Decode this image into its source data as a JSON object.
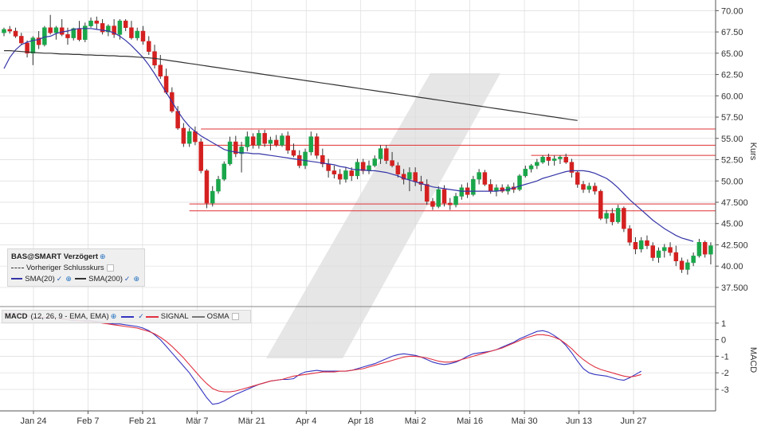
{
  "chart_data": {
    "type": "candlestick",
    "instrument": "BAS@SMART Verzögert",
    "x_ticks": [
      "Jan 24",
      "Feb 7",
      "Feb 21",
      "Mär 7",
      "Mär 21",
      "Apr 4",
      "Apr 18",
      "Mai 2",
      "Mai 16",
      "Mai 30",
      "Jun 13",
      "Jun 27"
    ],
    "price_axis": {
      "label": "Kurs",
      "ylim": [
        35.25,
        71.25
      ],
      "ticks": [
        "70.00",
        "67.50",
        "65.00",
        "62.50",
        "60.00",
        "57.50",
        "55.00",
        "52.50",
        "50.00",
        "47.500",
        "45.00",
        "42.500",
        "40.00",
        "37.500"
      ]
    },
    "macd_axis": {
      "label": "MACD",
      "ylim": [
        -4.3,
        2.0
      ],
      "ticks": [
        "1",
        "0",
        "-1",
        "-2",
        "-3"
      ]
    },
    "candles": [
      [
        67.4,
        68.0,
        67.0,
        67.8
      ],
      [
        67.8,
        68.2,
        67.3,
        67.6
      ],
      [
        67.6,
        68.0,
        66.8,
        67.0
      ],
      [
        67.0,
        67.4,
        66.0,
        66.2
      ],
      [
        66.2,
        66.5,
        64.5,
        65.0
      ],
      [
        65.0,
        67.0,
        63.6,
        66.8
      ],
      [
        66.8,
        67.6,
        65.5,
        66.0
      ],
      [
        66.0,
        68.2,
        65.8,
        68.0
      ],
      [
        68.0,
        69.5,
        67.2,
        67.4
      ],
      [
        67.4,
        68.2,
        66.6,
        68.0
      ],
      [
        68.0,
        69.0,
        67.0,
        67.2
      ],
      [
        67.2,
        68.0,
        66.0,
        66.8
      ],
      [
        66.8,
        68.0,
        66.5,
        67.9
      ],
      [
        67.9,
        68.8,
        66.4,
        66.6
      ],
      [
        66.6,
        68.6,
        66.3,
        68.2
      ],
      [
        68.2,
        69.2,
        68.0,
        68.8
      ],
      [
        68.8,
        69.3,
        67.8,
        68.5
      ],
      [
        68.5,
        69.0,
        67.2,
        67.5
      ],
      [
        67.5,
        68.4,
        67.0,
        68.2
      ],
      [
        68.2,
        69.0,
        66.8,
        67.2
      ],
      [
        67.2,
        69.0,
        66.6,
        68.8
      ],
      [
        68.8,
        69.0,
        67.6,
        68.0
      ],
      [
        68.0,
        68.8,
        66.6,
        66.8
      ],
      [
        66.8,
        68.0,
        66.5,
        67.6
      ],
      [
        67.6,
        68.2,
        66.0,
        66.4
      ],
      [
        66.4,
        67.0,
        64.8,
        65.2
      ],
      [
        65.2,
        66.0,
        63.2,
        63.6
      ],
      [
        63.6,
        64.8,
        62.0,
        62.3
      ],
      [
        62.3,
        63.2,
        60.2,
        60.4
      ],
      [
        60.4,
        61.0,
        58.0,
        58.2
      ],
      [
        58.2,
        58.8,
        56.0,
        56.2
      ],
      [
        56.2,
        56.8,
        54.0,
        54.4
      ],
      [
        54.4,
        56.2,
        54.0,
        55.8
      ],
      [
        55.8,
        56.4,
        54.2,
        54.6
      ],
      [
        54.6,
        55.0,
        50.9,
        51.2
      ],
      [
        51.2,
        51.4,
        46.8,
        47.4
      ],
      [
        47.4,
        49.4,
        47.0,
        48.8
      ],
      [
        48.8,
        50.6,
        48.5,
        50.2
      ],
      [
        50.2,
        52.3,
        50.0,
        52.0
      ],
      [
        52.0,
        55.2,
        51.8,
        54.6
      ],
      [
        54.6,
        55.3,
        52.8,
        53.2
      ],
      [
        53.2,
        54.6,
        51.0,
        54.0
      ],
      [
        54.0,
        55.8,
        53.5,
        55.2
      ],
      [
        55.2,
        55.6,
        53.8,
        54.2
      ],
      [
        54.2,
        56.0,
        53.8,
        55.6
      ],
      [
        55.6,
        56.0,
        54.0,
        54.4
      ],
      [
        54.4,
        55.2,
        53.6,
        54.8
      ],
      [
        54.8,
        55.4,
        54.0,
        54.2
      ],
      [
        54.2,
        55.6,
        54.0,
        55.3
      ],
      [
        55.3,
        55.8,
        53.2,
        53.6
      ],
      [
        53.6,
        54.4,
        52.8,
        53.0
      ],
      [
        53.0,
        53.6,
        51.5,
        51.8
      ],
      [
        51.8,
        53.8,
        51.4,
        53.4
      ],
      [
        53.4,
        55.8,
        53.0,
        55.2
      ],
      [
        55.2,
        55.6,
        52.6,
        53.0
      ],
      [
        53.0,
        53.8,
        51.6,
        52.0
      ],
      [
        52.0,
        52.6,
        50.4,
        51.2
      ],
      [
        51.2,
        51.8,
        50.3,
        50.8
      ],
      [
        50.8,
        51.4,
        49.6,
        50.2
      ],
      [
        50.2,
        51.6,
        49.8,
        51.2
      ],
      [
        51.2,
        51.6,
        50.0,
        50.6
      ],
      [
        50.6,
        52.6,
        50.2,
        52.2
      ],
      [
        52.2,
        52.6,
        50.8,
        51.2
      ],
      [
        51.2,
        52.4,
        50.8,
        51.8
      ],
      [
        51.8,
        53.0,
        51.6,
        52.6
      ],
      [
        52.6,
        54.2,
        52.0,
        53.8
      ],
      [
        53.8,
        54.2,
        52.0,
        52.4
      ],
      [
        52.4,
        53.4,
        51.6,
        51.8
      ],
      [
        51.8,
        52.2,
        50.4,
        50.8
      ],
      [
        50.8,
        51.4,
        49.6,
        50.2
      ],
      [
        50.2,
        51.6,
        48.8,
        51.0
      ],
      [
        51.0,
        51.6,
        49.4,
        49.9
      ],
      [
        49.9,
        50.6,
        48.8,
        49.6
      ],
      [
        49.6,
        50.2,
        47.2,
        47.6
      ],
      [
        47.6,
        48.0,
        46.6,
        47.0
      ],
      [
        47.0,
        49.4,
        46.8,
        49.0
      ],
      [
        49.0,
        49.5,
        47.0,
        47.4
      ],
      [
        47.4,
        48.0,
        46.6,
        47.2
      ],
      [
        47.2,
        48.6,
        46.9,
        48.2
      ],
      [
        48.2,
        49.6,
        47.8,
        49.2
      ],
      [
        49.2,
        49.8,
        48.0,
        48.4
      ],
      [
        48.4,
        50.6,
        48.2,
        50.2
      ],
      [
        50.2,
        51.4,
        49.6,
        51.0
      ],
      [
        51.0,
        51.3,
        49.4,
        49.6
      ],
      [
        49.6,
        50.2,
        48.5,
        48.8
      ],
      [
        48.8,
        49.6,
        48.2,
        49.2
      ],
      [
        49.2,
        49.6,
        48.6,
        48.8
      ],
      [
        48.8,
        49.6,
        48.4,
        49.3
      ],
      [
        49.3,
        49.8,
        48.6,
        49.0
      ],
      [
        49.0,
        50.8,
        48.8,
        50.6
      ],
      [
        50.6,
        51.8,
        50.4,
        51.4
      ],
      [
        51.4,
        52.0,
        51.0,
        51.8
      ],
      [
        51.8,
        52.6,
        51.4,
        52.2
      ],
      [
        52.2,
        53.0,
        52.0,
        52.8
      ],
      [
        52.8,
        53.2,
        51.8,
        52.4
      ],
      [
        52.4,
        53.0,
        51.8,
        52.6
      ],
      [
        52.6,
        53.0,
        52.0,
        52.8
      ],
      [
        52.8,
        53.2,
        52.0,
        52.2
      ],
      [
        52.2,
        52.6,
        50.4,
        51.0
      ],
      [
        51.0,
        51.2,
        49.2,
        49.6
      ],
      [
        49.6,
        50.0,
        48.6,
        49.0
      ],
      [
        49.0,
        49.8,
        48.6,
        49.4
      ],
      [
        49.4,
        49.8,
        48.4,
        48.8
      ],
      [
        48.8,
        49.0,
        45.4,
        45.6
      ],
      [
        45.6,
        46.6,
        45.0,
        46.2
      ],
      [
        46.2,
        46.8,
        44.8,
        45.2
      ],
      [
        45.2,
        47.2,
        45.0,
        46.8
      ],
      [
        46.8,
        47.0,
        44.0,
        44.4
      ],
      [
        44.4,
        44.8,
        42.4,
        42.8
      ],
      [
        42.8,
        43.4,
        41.4,
        42.0
      ],
      [
        42.0,
        43.4,
        41.6,
        43.0
      ],
      [
        43.0,
        43.6,
        42.0,
        42.4
      ],
      [
        42.4,
        42.8,
        40.6,
        41.0
      ],
      [
        41.0,
        42.2,
        40.4,
        41.8
      ],
      [
        41.8,
        42.6,
        41.0,
        42.2
      ],
      [
        42.2,
        42.8,
        41.2,
        41.6
      ],
      [
        41.6,
        42.4,
        40.0,
        40.6
      ],
      [
        40.6,
        41.0,
        39.2,
        39.6
      ],
      [
        39.6,
        40.8,
        39.0,
        40.4
      ],
      [
        40.4,
        41.6,
        40.0,
        41.2
      ],
      [
        41.2,
        43.2,
        41.0,
        42.8
      ],
      [
        42.8,
        43.0,
        41.0,
        41.4
      ],
      [
        41.4,
        42.8,
        40.2,
        42.4
      ]
    ],
    "horizontal_lines": [
      {
        "value": 56.1,
        "from": 34
      },
      {
        "value": 54.2,
        "from": 34
      },
      {
        "value": 53.0,
        "from": 91
      },
      {
        "value": 47.3,
        "from": 32
      },
      {
        "value": 46.5,
        "from": 32
      }
    ],
    "series": [
      {
        "name": "SMA(20)",
        "color": "#3535a8",
        "values": [
          63.2,
          64.5,
          65.4,
          66.0,
          66.3,
          66.5,
          66.6,
          66.9,
          67.0,
          67.3,
          67.5,
          67.6,
          67.8,
          67.9,
          67.9,
          67.9,
          67.8,
          67.7,
          67.6,
          67.4,
          67.0,
          66.5,
          65.9,
          65.2,
          64.5,
          63.6,
          62.6,
          61.5,
          60.4,
          59.3,
          58.2,
          57.2,
          56.4,
          55.8,
          55.3,
          54.9,
          54.5,
          54.1,
          53.7,
          53.5,
          53.4,
          53.3,
          53.3,
          53.2,
          53.2,
          53.1,
          53.0,
          52.9,
          52.8,
          52.7,
          52.6,
          52.5,
          52.4,
          52.3,
          52.2,
          52.1,
          52.0,
          51.9,
          51.7,
          51.6,
          51.4,
          51.3,
          51.3,
          51.2,
          51.2,
          51.1,
          51.0,
          50.8,
          50.6,
          50.3,
          50.1,
          49.9,
          49.7,
          49.5,
          49.3,
          49.2,
          49.1,
          49.0,
          48.9,
          48.8,
          48.8,
          48.8,
          48.8,
          48.8,
          48.8,
          48.8,
          48.9,
          49.0,
          49.2,
          49.4,
          49.6,
          49.8,
          50.0,
          50.3,
          50.5,
          50.7,
          50.9,
          51.1,
          51.2,
          51.2,
          51.2,
          51.1,
          50.9,
          50.6,
          50.3,
          49.8,
          49.2,
          48.5,
          47.8,
          47.2,
          46.6,
          46.0,
          45.4,
          44.9,
          44.4,
          44.0,
          43.6,
          43.3,
          43.1,
          42.9
        ]
      },
      {
        "name": "SMA(200)",
        "color": "#333333",
        "values": [
          65.3,
          65.3,
          65.25,
          65.2,
          65.15,
          65.1,
          65.05,
          65.0,
          65.0,
          64.95,
          64.9,
          64.9,
          64.85,
          64.85,
          64.8,
          64.8,
          64.75,
          64.75,
          64.7,
          64.7,
          64.65,
          64.65,
          64.6,
          64.55,
          64.5,
          64.45,
          64.4,
          64.3,
          64.2,
          64.1,
          64.0,
          63.9,
          63.8,
          63.7,
          63.6,
          63.5,
          63.4,
          63.3,
          63.2,
          63.1,
          63.0,
          62.9,
          62.8,
          62.7,
          62.6,
          62.5,
          62.4,
          62.3,
          62.2,
          62.1,
          62.0,
          61.9,
          61.8,
          61.7,
          61.6,
          61.5,
          61.4,
          61.3,
          61.2,
          61.1,
          61.0,
          60.9,
          60.8,
          60.7,
          60.6,
          60.5,
          60.4,
          60.3,
          60.2,
          60.1,
          60.0,
          59.9,
          59.8,
          59.7,
          59.6,
          59.5,
          59.4,
          59.3,
          59.2,
          59.1,
          59.0,
          58.9,
          58.8,
          58.7,
          58.6,
          58.5,
          58.4,
          58.3,
          58.2,
          58.1,
          58.0,
          57.9,
          57.8,
          57.7,
          57.6,
          57.5,
          57.4,
          57.3,
          57.2,
          57.1
        ]
      },
      {
        "name": "MACD",
        "color": "#3535c0",
        "values": [
          1.55,
          1.6,
          1.6,
          1.55,
          1.45,
          1.35,
          1.3,
          1.3,
          1.35,
          1.35,
          1.3,
          1.2,
          1.15,
          1.15,
          1.15,
          1.15,
          1.1,
          1.05,
          1.0,
          0.95,
          0.95,
          0.9,
          0.85,
          0.8,
          0.7,
          0.55,
          0.3,
          0.0,
          -0.4,
          -0.8,
          -1.2,
          -1.6,
          -2.0,
          -2.5,
          -3.0,
          -3.5,
          -3.9,
          -3.85,
          -3.7,
          -3.5,
          -3.3,
          -3.15,
          -3.0,
          -2.85,
          -2.7,
          -2.6,
          -2.5,
          -2.45,
          -2.4,
          -2.4,
          -2.35,
          -2.1,
          -1.95,
          -1.9,
          -1.85,
          -1.9,
          -1.9,
          -1.9,
          -1.9,
          -1.9,
          -1.85,
          -1.75,
          -1.65,
          -1.55,
          -1.45,
          -1.3,
          -1.15,
          -1.0,
          -0.9,
          -0.85,
          -0.9,
          -0.95,
          -1.05,
          -1.2,
          -1.35,
          -1.45,
          -1.5,
          -1.45,
          -1.35,
          -1.2,
          -1.0,
          -0.85,
          -0.8,
          -0.75,
          -0.7,
          -0.6,
          -0.45,
          -0.3,
          -0.15,
          0.05,
          0.2,
          0.35,
          0.5,
          0.55,
          0.45,
          0.25,
          0.0,
          -0.35,
          -0.8,
          -1.3,
          -1.75,
          -2.0,
          -2.1,
          -2.15,
          -2.2,
          -2.3,
          -2.4,
          -2.45,
          -2.3,
          -2.1,
          -1.9
        ]
      },
      {
        "name": "SIGNAL",
        "color": "#e03040",
        "values": [
          1.6,
          1.55,
          1.55,
          1.5,
          1.45,
          1.4,
          1.35,
          1.35,
          1.35,
          1.3,
          1.25,
          1.2,
          1.2,
          1.15,
          1.1,
          1.1,
          1.05,
          1.0,
          0.95,
          0.9,
          0.85,
          0.8,
          0.75,
          0.7,
          0.6,
          0.5,
          0.35,
          0.15,
          -0.1,
          -0.4,
          -0.75,
          -1.1,
          -1.5,
          -1.9,
          -2.3,
          -2.65,
          -2.95,
          -3.1,
          -3.15,
          -3.15,
          -3.1,
          -3.0,
          -2.9,
          -2.8,
          -2.7,
          -2.6,
          -2.5,
          -2.45,
          -2.4,
          -2.3,
          -2.2,
          -2.15,
          -2.1,
          -2.05,
          -2.0,
          -1.95,
          -1.95,
          -1.95,
          -1.9,
          -1.9,
          -1.85,
          -1.8,
          -1.75,
          -1.65,
          -1.55,
          -1.45,
          -1.35,
          -1.25,
          -1.15,
          -1.05,
          -1.0,
          -1.0,
          -1.05,
          -1.1,
          -1.2,
          -1.3,
          -1.35,
          -1.35,
          -1.3,
          -1.2,
          -1.1,
          -1.0,
          -0.9,
          -0.8,
          -0.7,
          -0.6,
          -0.5,
          -0.35,
          -0.2,
          -0.05,
          0.1,
          0.2,
          0.3,
          0.3,
          0.25,
          0.15,
          0.0,
          -0.25,
          -0.55,
          -0.9,
          -1.2,
          -1.45,
          -1.65,
          -1.8,
          -1.9,
          -2.0,
          -2.1,
          -2.2,
          -2.25,
          -2.2,
          -2.1
        ]
      }
    ]
  },
  "legend_main": {
    "title": "BAS@SMART Verzögert",
    "prev_close": "Vorheriger Schlusskurs",
    "sma20": "SMA(20)",
    "sma200": "SMA(200)"
  },
  "legend_macd": {
    "title": "MACD",
    "params": "(12, 26, 9 - EMA, EMA)",
    "signal": "SIGNAL",
    "osma": "OSMA"
  },
  "colors": {
    "bullish": "#1aa64a",
    "bearish": "#d42020",
    "support_lines": "#e03030",
    "grid": "#dcdcdc",
    "watermark": "#e6e6e6"
  }
}
